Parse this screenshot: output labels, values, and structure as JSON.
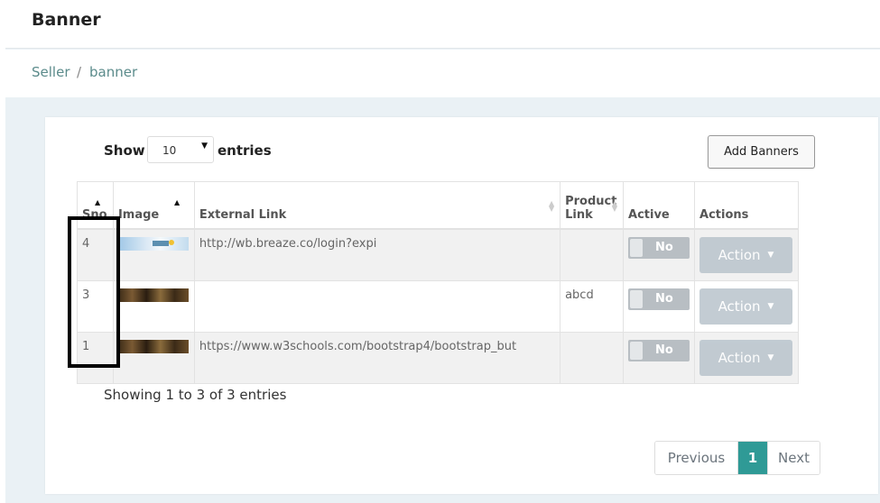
{
  "header": {
    "title": "Banner"
  },
  "breadcrumb": {
    "parent": "Seller",
    "separator": "/",
    "current": "banner"
  },
  "controls": {
    "show_label": "Show",
    "page_size": "10",
    "entries_label": "entries",
    "add_button": "Add Banners"
  },
  "table": {
    "columns": {
      "sno": "Sno",
      "image": "Image",
      "external_link": "External Link",
      "product_link_line1": "Product",
      "product_link_line2": "Link",
      "active": "Active",
      "actions": "Actions"
    },
    "rows": [
      {
        "sno": "4",
        "image": "light-banner-thumbnail",
        "external_link": "http://wb.breaze.co/login?expi",
        "product_link": "",
        "active": "No",
        "action": "Action"
      },
      {
        "sno": "3",
        "image": "dark-banner-thumbnail",
        "external_link": "",
        "product_link": "abcd",
        "active": "No",
        "action": "Action"
      },
      {
        "sno": "1",
        "image": "dark-banner-thumbnail",
        "external_link": "https://www.w3schools.com/bootstrap4/bootstrap_but",
        "product_link": "",
        "active": "No",
        "action": "Action"
      }
    ]
  },
  "footer": {
    "info": "Showing 1 to 3 of 3 entries"
  },
  "pagination": {
    "previous": "Previous",
    "current": "1",
    "next": "Next"
  },
  "colors": {
    "accent": "#2f9a96",
    "breadcrumb": "#5b8b8b",
    "toggle_off": "#b8bec3"
  }
}
